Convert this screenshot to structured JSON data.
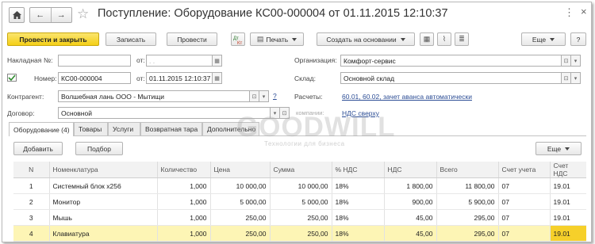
{
  "window": {
    "title": "Поступление: Оборудование КС00-000004 от 01.11.2015 12:10:37",
    "more_dots": "⋮",
    "close": "×"
  },
  "toolbar": {
    "post_close": "Провести и закрыть",
    "write": "Записать",
    "post": "Провести",
    "print": "Печать",
    "create_based": "Создать на основании",
    "more": "Еще",
    "help": "?"
  },
  "form": {
    "invoice_label": "Накладная",
    "no_label": "№:",
    "invoice_no_value": "",
    "from_label": "от:",
    "invoice_date_placeholder": ". .",
    "number_label": "Номер:",
    "number_value": "КС00-000004",
    "from_label2": "от:",
    "date_value": "01.11.2015 12:10:37",
    "org_label": "Организация:",
    "org_value": "Комфорт-сервис",
    "warehouse_label": "Склад:",
    "warehouse_value": "Основной склад",
    "counterparty_label": "Контрагент:",
    "counterparty_value": "Волшебная лань ООО - Мытищи",
    "question": "?",
    "settlements_label": "Расчеты:",
    "settlements_value": "60.01, 60.02, зачет аванса автоматически",
    "contract_label": "Договор:",
    "contract_value": "Основной",
    "vat_link": "НДС сверху",
    "companies_label": "компании:"
  },
  "tabs": [
    {
      "label": "Оборудование (4)"
    },
    {
      "label": "Товары"
    },
    {
      "label": "Услуги"
    },
    {
      "label": "Возвратная тара"
    },
    {
      "label": "Дополнительно"
    }
  ],
  "table_toolbar": {
    "add": "Добавить",
    "select": "Подбор",
    "more": "Еще"
  },
  "table": {
    "columns": [
      "N",
      "Номенклатура",
      "Количество",
      "Цена",
      "Сумма",
      "% НДС",
      "НДС",
      "Всего",
      "Счет учета",
      "Счет НДС"
    ],
    "rows": [
      [
        "1",
        "Системный блок x256",
        "1,000",
        "10 000,00",
        "10 000,00",
        "18%",
        "1 800,00",
        "11 800,00",
        "07",
        "19.01"
      ],
      [
        "2",
        "Монитор",
        "1,000",
        "5 000,00",
        "5 000,00",
        "18%",
        "900,00",
        "5 900,00",
        "07",
        "19.01"
      ],
      [
        "3",
        "Мышь",
        "1,000",
        "250,00",
        "250,00",
        "18%",
        "45,00",
        "295,00",
        "07",
        "19.01"
      ],
      [
        "4",
        "Клавиатура",
        "1,000",
        "250,00",
        "250,00",
        "18%",
        "45,00",
        "295,00",
        "07",
        "19.01"
      ]
    ]
  },
  "watermark": {
    "brand": "GOODWILL",
    "tagline": "Технологии для бизнеса"
  },
  "colors": {
    "primary_button": "#f4cf17",
    "link": "#2c4d95",
    "selected_row": "#fdf5b5",
    "current_cell": "#f6d02a"
  }
}
